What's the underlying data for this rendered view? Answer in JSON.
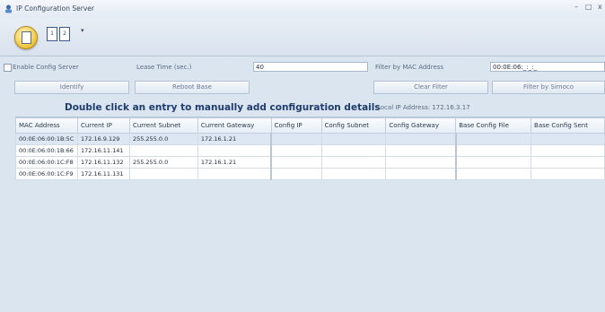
{
  "window": {
    "title": "IP Configuration Server",
    "minimize_glyph": "–",
    "maximize_glyph": "□",
    "close_glyph": "x"
  },
  "toolbar": {
    "qat_icon_1": "1",
    "qat_icon_2": "2",
    "qat_dropdown": "▾"
  },
  "settings": {
    "enable_config_label": "Enable Config Server",
    "enable_config_checked": false,
    "lease_time_label": "Lease Time (sec.)",
    "lease_time_value": "40",
    "filter_mac_label": "Filter by MAC Address",
    "filter_mac_value": "00:0E:06:_:_:_"
  },
  "buttons": {
    "identify": "Identify",
    "reboot": "Reboot Base",
    "clear_filter": "Clear Filter",
    "filter_simoco": "Filter by Simoco"
  },
  "headline": "Double click an entry to manually add configuration details",
  "local_ip": "Local IP Address: 172.16.3.17",
  "table": {
    "columns": [
      "MAC Address",
      "Current IP",
      "Current Subnet",
      "Current Gateway",
      "Config IP",
      "Config Subnet",
      "Config Gateway",
      "Base Config File",
      "Base Config Sent"
    ],
    "rows": [
      [
        "00:0E:06:00:1B:5C",
        "172.16.9.129",
        "255.255.0.0",
        "172.16.1.21",
        "",
        "",
        "",
        "",
        ""
      ],
      [
        "00:0E:06:00:1B:66",
        "172.16.11.141",
        "",
        "",
        "",
        "",
        "",
        "",
        ""
      ],
      [
        "00:0E:06:00:1C:F8",
        "172.16.11.132",
        "255.255.0.0",
        "172.16.1.21",
        "",
        "",
        "",
        "",
        ""
      ],
      [
        "00:0E:06:00:1C:F9",
        "172.16.11.131",
        "",
        "",
        "",
        "",
        "",
        "",
        ""
      ]
    ]
  },
  "colors": {
    "headline": "#1f3c6e",
    "background": "#dbe5f0"
  }
}
